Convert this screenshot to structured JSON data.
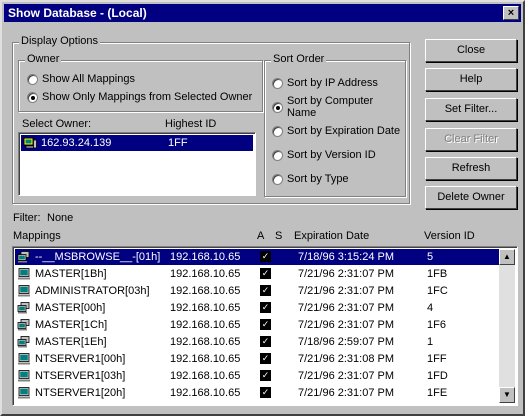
{
  "window": {
    "title": "Show Database - (Local)",
    "close_glyph": "×"
  },
  "display_options": {
    "label": "Display Options",
    "owner": {
      "label": "Owner",
      "options": [
        "Show All Mappings",
        "Show Only Mappings from Selected Owner"
      ],
      "selected_index": 1
    },
    "select_owner_label": "Select Owner:",
    "highest_id_label": "Highest ID",
    "owners": [
      {
        "address": "162.93.24.139",
        "highest_id": "1FF"
      }
    ]
  },
  "sort_order": {
    "label": "Sort Order",
    "options": [
      "Sort by IP Address",
      "Sort by Computer Name",
      "Sort by Expiration Date",
      "Sort by Version ID",
      "Sort by Type"
    ],
    "selected_index": 1
  },
  "buttons": {
    "close": "Close",
    "help": "Help",
    "set_filter": "Set Filter...",
    "clear_filter": "Clear Filter",
    "refresh": "Refresh",
    "delete_owner": "Delete Owner"
  },
  "filter": {
    "label": "Filter:",
    "value": "None"
  },
  "mappings": {
    "label": "Mappings",
    "columns": {
      "a": "A",
      "s": "S",
      "expiration": "Expiration Date",
      "version": "Version ID"
    },
    "rows": [
      {
        "name": "--__MSBROWSE__-[01h]",
        "ip": "192.168.10.65",
        "a": true,
        "expiration": "7/18/96 3:15:24 PM",
        "version": "5",
        "icon": "group-computer-icon"
      },
      {
        "name": "MASTER[1Bh]",
        "ip": "192.168.10.65",
        "a": true,
        "expiration": "7/21/96 2:31:07 PM",
        "version": "1FB",
        "icon": "computer-icon"
      },
      {
        "name": "ADMINISTRATOR[03h]",
        "ip": "192.168.10.65",
        "a": true,
        "expiration": "7/21/96 2:31:07 PM",
        "version": "1FC",
        "icon": "computer-icon"
      },
      {
        "name": "MASTER[00h]",
        "ip": "192.168.10.65",
        "a": true,
        "expiration": "7/21/96 2:31:07 PM",
        "version": "4",
        "icon": "group-computer-icon"
      },
      {
        "name": "MASTER[1Ch]",
        "ip": "192.168.10.65",
        "a": true,
        "expiration": "7/21/96 2:31:07 PM",
        "version": "1F6",
        "icon": "group-computer-icon"
      },
      {
        "name": "MASTER[1Eh]",
        "ip": "192.168.10.65",
        "a": true,
        "expiration": "7/18/96 2:59:07 PM",
        "version": "1",
        "icon": "group-computer-icon"
      },
      {
        "name": "NTSERVER1[00h]",
        "ip": "192.168.10.65",
        "a": true,
        "expiration": "7/21/96 2:31:08 PM",
        "version": "1FF",
        "icon": "computer-icon"
      },
      {
        "name": "NTSERVER1[03h]",
        "ip": "192.168.10.65",
        "a": true,
        "expiration": "7/21/96 2:31:07 PM",
        "version": "1FD",
        "icon": "computer-icon"
      },
      {
        "name": "NTSERVER1[20h]",
        "ip": "192.168.10.65",
        "a": true,
        "expiration": "7/21/96 2:31:07 PM",
        "version": "1FE",
        "icon": "computer-icon"
      }
    ],
    "selected_index": 0
  },
  "colors": {
    "titlebar": "#000080",
    "selection": "#000080",
    "face": "#c0c0c0"
  }
}
